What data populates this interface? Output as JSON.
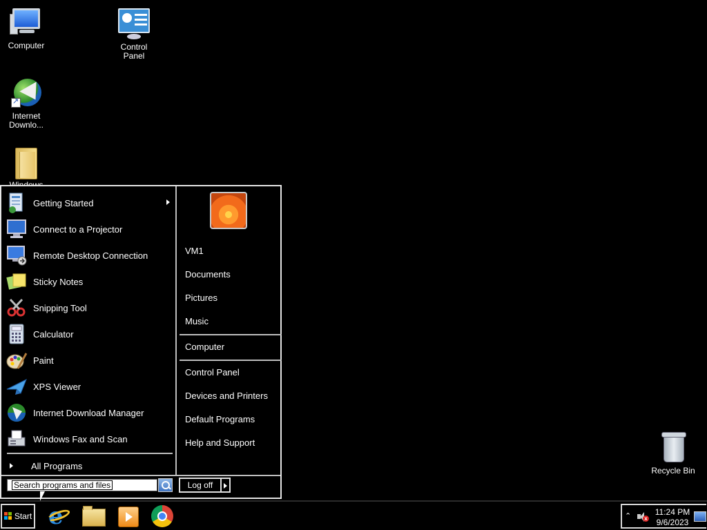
{
  "desktop": {
    "icons": [
      {
        "label": "Computer",
        "icon": "computer-icon"
      },
      {
        "label": "Control\nPanel",
        "icon": "control-panel-icon"
      },
      {
        "label": "Internet\nDownlo...",
        "icon": "internet-download-manager-icon"
      },
      {
        "label": "Windows Fa...",
        "icon": "folder-icon"
      },
      {
        "label": "Recycle Bin",
        "icon": "recycle-bin-icon"
      }
    ]
  },
  "start_menu": {
    "programs": [
      {
        "label": "Getting Started",
        "icon": "getting-started-icon",
        "has_submenu": true
      },
      {
        "label": "Connect to a Projector",
        "icon": "projector-icon"
      },
      {
        "label": "Remote Desktop Connection",
        "icon": "remote-desktop-icon"
      },
      {
        "label": "Sticky Notes",
        "icon": "sticky-notes-icon"
      },
      {
        "label": "Snipping Tool",
        "icon": "snipping-tool-icon"
      },
      {
        "label": "Calculator",
        "icon": "calculator-icon"
      },
      {
        "label": "Paint",
        "icon": "paint-icon"
      },
      {
        "label": "XPS Viewer",
        "icon": "xps-viewer-icon"
      },
      {
        "label": "Internet Download Manager",
        "icon": "internet-download-manager-icon"
      },
      {
        "label": "Windows Fax and Scan",
        "icon": "fax-scan-icon"
      }
    ],
    "all_programs_label": "All Programs",
    "right_items": {
      "user": "VM1",
      "documents": "Documents",
      "pictures": "Pictures",
      "music": "Music",
      "computer": "Computer",
      "control_panel": "Control Panel",
      "devices_printers": "Devices and Printers",
      "default_programs": "Default Programs",
      "help_support": "Help and Support"
    },
    "search_placeholder": "Search programs and files",
    "logoff_label": "Log off"
  },
  "taskbar": {
    "start_label": "Start",
    "pinned": [
      "internet-explorer-icon",
      "windows-explorer-icon",
      "media-player-icon",
      "chrome-icon"
    ],
    "tray": {
      "time": "11:24 PM",
      "date": "9/6/2023",
      "chevron": "⌃",
      "mute_mark": "x"
    }
  },
  "colors": {
    "background": "#000000",
    "menu_border": "#e6e6e6",
    "text": "#ffffff"
  }
}
